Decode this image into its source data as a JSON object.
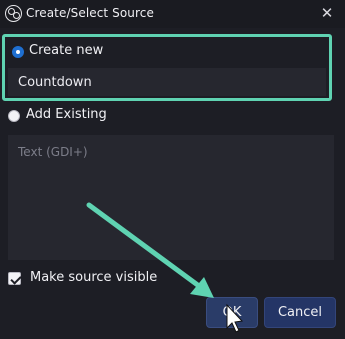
{
  "window": {
    "title": "Create/Select Source",
    "app_icon": "obs-logo-icon",
    "close_icon": "close-icon",
    "close_glyph": "✕"
  },
  "create_new": {
    "label": "Create new",
    "selected": true,
    "name_value": "Countdown"
  },
  "add_existing": {
    "label": "Add Existing",
    "selected": false,
    "sources": [
      "Text (GDI+)"
    ]
  },
  "make_visible": {
    "label": "Make source visible",
    "checked": true
  },
  "buttons": {
    "ok_label": "OK",
    "cancel_label": "Cancel"
  },
  "colors": {
    "highlight": "#5fd3b2",
    "background": "#1d1e25",
    "field_bg": "#26272f",
    "radio_selected": "#1f6fd1",
    "button_bg": "#243566"
  }
}
